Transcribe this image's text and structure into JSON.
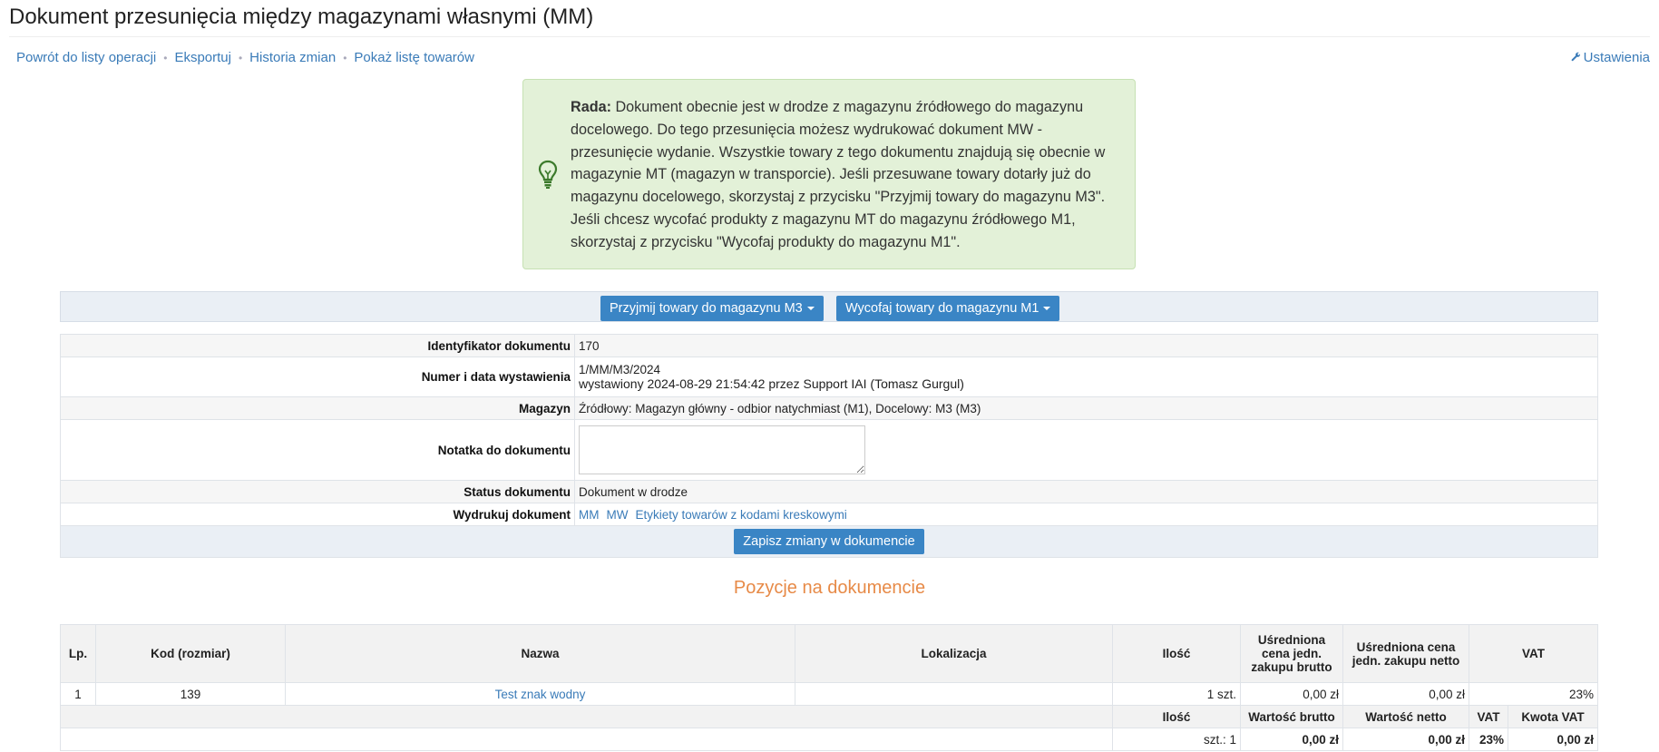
{
  "page": {
    "title": "Dokument przesunięcia między magazynami własnymi (MM)"
  },
  "nav": {
    "items": [
      "Powrót do listy operacji",
      "Eksportuj",
      "Historia zmian",
      "Pokaż listę towarów"
    ],
    "settings": "Ustawienia"
  },
  "tip": {
    "label": "Rada:",
    "text": "Dokument obecnie jest w drodze z magazynu źródłowego do magazynu docelowego. Do tego przesunięcia możesz wydrukować dokument MW - przesunięcie wydanie. Wszystkie towary z tego dokumentu znajdują się obecnie w magazynie MT (magazyn w transporcie). Jeśli przesuwane towary dotarły już do magazynu docelowego, skorzystaj z przycisku \"Przyjmij towary do magazynu M3\". Jeśli chcesz wycofać produkty z magazynu MT do magazynu źródłowego M1, skorzystaj z przycisku \"Wycofaj produkty do magazynu M1\".",
    "icon": "lightbulb-icon",
    "color": "#e3f1d8"
  },
  "actions": {
    "accept": "Przyjmij towary do magazynu M3",
    "withdraw": "Wycofaj towary do magazynu M1"
  },
  "details": {
    "id_label": "Identyfikator dokumentu",
    "id_value": "170",
    "number_label": "Numer i data wystawienia",
    "number_value": "1/MM/M3/2024",
    "issued_value": "wystawiony 2024-08-29 21:54:42 przez Support IAI (Tomasz Gurgul)",
    "warehouse_label": "Magazyn",
    "warehouse_value": "Źródłowy: Magazyn główny - odbior natychmiast (M1), Docelowy: M3 (M3)",
    "note_label": "Notatka do dokumentu",
    "note_value": "",
    "status_label": "Status dokumentu",
    "status_value": "Dokument w drodze",
    "print_label": "Wydrukuj dokument",
    "print_links": [
      "MM",
      "MW",
      "Etykiety towarów z kodami kreskowymi"
    ],
    "save": "Zapisz zmiany w dokumencie"
  },
  "items_section": {
    "title": "Pozycje na dokumencie",
    "columns": [
      "Lp.",
      "Kod (rozmiar)",
      "Nazwa",
      "Lokalizacja",
      "Ilość",
      "Uśredniona cena jedn. zakupu brutto",
      "Uśredniona cena jedn. zakupu netto",
      "VAT"
    ],
    "rows": [
      {
        "lp": "1",
        "code": "139",
        "name": "Test znak wodny",
        "location": "",
        "qty": "1 szt.",
        "gross": "0,00 zł",
        "net": "0,00 zł",
        "vat": "23%"
      }
    ],
    "summary_columns": [
      "Ilość",
      "Wartość brutto",
      "Wartość netto",
      "VAT",
      "Kwota VAT"
    ],
    "summary": {
      "qty": "szt.: 1",
      "gross": "0,00 zł",
      "net": "0,00 zł",
      "vat": "23%",
      "vat_amount": "0,00 zł"
    }
  },
  "colors": {
    "accent": "#3a85c5",
    "link": "#3a7bb8",
    "section_title": "#e78a47"
  }
}
